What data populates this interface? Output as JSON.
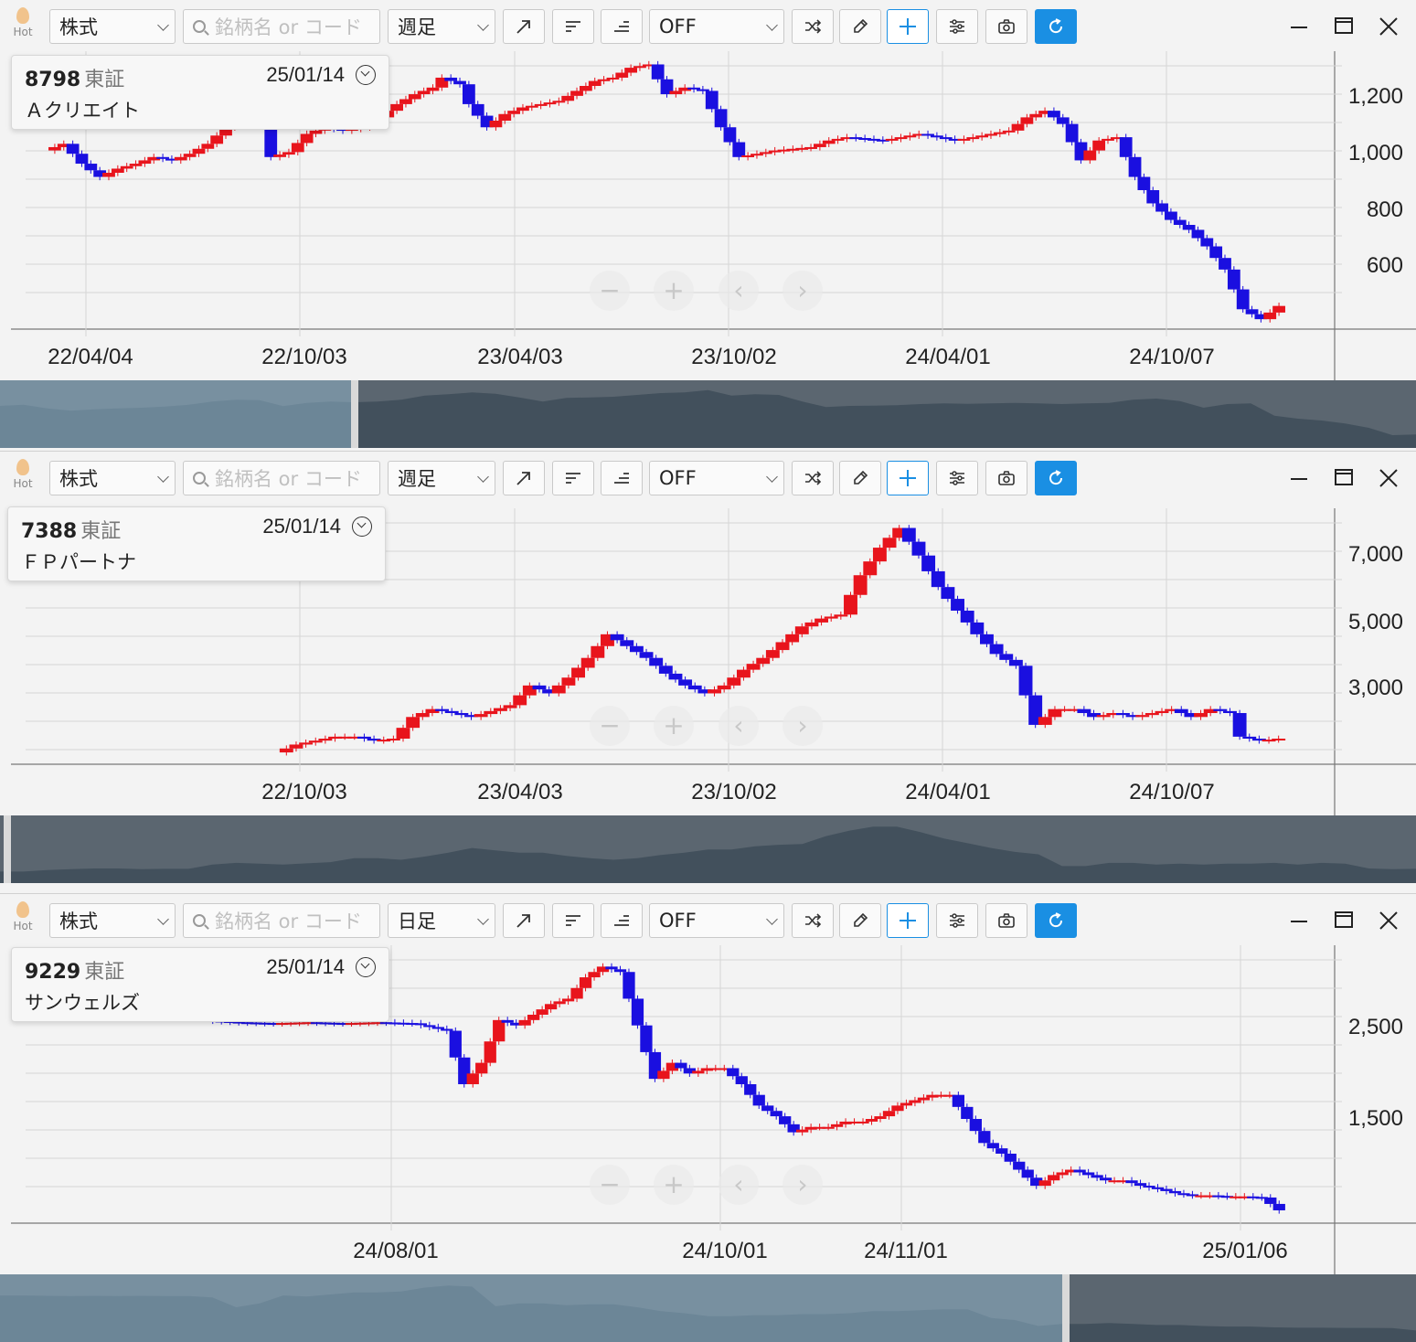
{
  "panels": [
    {
      "hot": "Hot",
      "market": "株式",
      "search_placeholder": "銘柄名 or コード",
      "period": "週足",
      "mode": "OFF",
      "code": "8798",
      "exchange": "東証",
      "date": "25/01/14",
      "name": "Ａクリエイト",
      "y_ticks": [
        "1,200",
        "1,000",
        "800",
        "600"
      ],
      "x_ticks": [
        "22/04/04",
        "22/10/03",
        "23/04/03",
        "23/10/02",
        "24/04/01",
        "24/10/07"
      ]
    },
    {
      "hot": "Hot",
      "market": "株式",
      "search_placeholder": "銘柄名 or コード",
      "period": "週足",
      "mode": "OFF",
      "code": "7388",
      "exchange": "東証",
      "date": "25/01/14",
      "name": "ＦＰパートナ",
      "y_ticks": [
        "7,000",
        "5,000",
        "3,000"
      ],
      "x_ticks": [
        "22/10/03",
        "23/04/03",
        "23/10/02",
        "24/04/01",
        "24/10/07"
      ]
    },
    {
      "hot": "Hot",
      "market": "株式",
      "search_placeholder": "銘柄名 or コード",
      "period": "日足",
      "mode": "OFF",
      "code": "9229",
      "exchange": "東証",
      "date": "25/01/14",
      "name": "サンウェルズ",
      "y_ticks": [
        "2,500",
        "1,500"
      ],
      "x_ticks": [
        "24/08/01",
        "24/10/01",
        "24/11/01",
        "25/01/06"
      ]
    }
  ],
  "colors": {
    "up": "#e8141c",
    "down": "#1a0fe0",
    "accent": "#1a8fe3",
    "grid": "#d6d6d6"
  },
  "icons": [
    "line-tool-icon",
    "align-left-icon",
    "align-right-icon",
    "shuffle-icon",
    "pencil-icon",
    "crosshair-icon",
    "settings-sliders-icon",
    "camera-icon",
    "refresh-icon"
  ],
  "chart_data": [
    {
      "type": "candlestick",
      "series_points": [
        [
          0,
          980
        ],
        [
          2,
          1000
        ],
        [
          4,
          940
        ],
        [
          6,
          900
        ],
        [
          8,
          925
        ],
        [
          10,
          940
        ],
        [
          12,
          960
        ],
        [
          14,
          950
        ],
        [
          16,
          970
        ],
        [
          18,
          1000
        ],
        [
          20,
          1050
        ],
        [
          22,
          1080
        ],
        [
          24,
          1075
        ],
        [
          25,
          960
        ],
        [
          27,
          975
        ],
        [
          29,
          1030
        ],
        [
          31,
          1050
        ],
        [
          33,
          1040
        ],
        [
          35,
          1050
        ],
        [
          37,
          1080
        ],
        [
          39,
          1120
        ],
        [
          41,
          1150
        ],
        [
          43,
          1170
        ],
        [
          44,
          1200
        ],
        [
          46,
          1180
        ],
        [
          47,
          1120
        ],
        [
          49,
          1050
        ],
        [
          51,
          1090
        ],
        [
          53,
          1110
        ],
        [
          55,
          1120
        ],
        [
          57,
          1130
        ],
        [
          59,
          1160
        ],
        [
          61,
          1190
        ],
        [
          63,
          1200
        ],
        [
          65,
          1230
        ],
        [
          67,
          1240
        ],
        [
          69,
          1150
        ],
        [
          71,
          1170
        ],
        [
          73,
          1160
        ],
        [
          75,
          1050
        ],
        [
          77,
          960
        ],
        [
          79,
          970
        ],
        [
          81,
          980
        ],
        [
          83,
          985
        ],
        [
          85,
          990
        ],
        [
          87,
          1010
        ],
        [
          89,
          1020
        ],
        [
          91,
          1015
        ],
        [
          93,
          1010
        ],
        [
          95,
          1020
        ],
        [
          97,
          1030
        ],
        [
          99,
          1020
        ],
        [
          101,
          1010
        ],
        [
          103,
          1020
        ],
        [
          105,
          1030
        ],
        [
          107,
          1040
        ],
        [
          109,
          1080
        ],
        [
          111,
          1100
        ],
        [
          113,
          1060
        ],
        [
          115,
          950
        ],
        [
          117,
          1010
        ],
        [
          119,
          1020
        ],
        [
          121,
          900
        ],
        [
          123,
          820
        ],
        [
          125,
          770
        ],
        [
          127,
          740
        ],
        [
          129,
          690
        ],
        [
          131,
          620
        ],
        [
          133,
          500
        ],
        [
          135,
          470
        ],
        [
          137,
          510
        ]
      ],
      "ylim": [
        440,
        1280
      ]
    },
    {
      "type": "candlestick",
      "series_points": [
        [
          0,
          1800
        ],
        [
          2,
          2000
        ],
        [
          4,
          2100
        ],
        [
          6,
          2200
        ],
        [
          8,
          2200
        ],
        [
          10,
          2100
        ],
        [
          12,
          2150
        ],
        [
          14,
          2700
        ],
        [
          16,
          2900
        ],
        [
          18,
          2800
        ],
        [
          20,
          2700
        ],
        [
          22,
          2850
        ],
        [
          24,
          3000
        ],
        [
          26,
          3500
        ],
        [
          28,
          3300
        ],
        [
          30,
          3700
        ],
        [
          32,
          4200
        ],
        [
          34,
          4800
        ],
        [
          36,
          4500
        ],
        [
          38,
          4200
        ],
        [
          40,
          3800
        ],
        [
          42,
          3500
        ],
        [
          44,
          3300
        ],
        [
          46,
          3500
        ],
        [
          48,
          3900
        ],
        [
          50,
          4200
        ],
        [
          52,
          4600
        ],
        [
          54,
          5000
        ],
        [
          56,
          5200
        ],
        [
          58,
          5300
        ],
        [
          60,
          6300
        ],
        [
          62,
          7000
        ],
        [
          64,
          7500
        ],
        [
          66,
          6800
        ],
        [
          68,
          6000
        ],
        [
          70,
          5400
        ],
        [
          72,
          4800
        ],
        [
          74,
          4300
        ],
        [
          76,
          4000
        ],
        [
          78,
          2500
        ],
        [
          80,
          2900
        ],
        [
          82,
          2900
        ],
        [
          84,
          2700
        ],
        [
          86,
          2800
        ],
        [
          88,
          2700
        ],
        [
          90,
          2800
        ],
        [
          92,
          2900
        ],
        [
          94,
          2700
        ],
        [
          96,
          2900
        ],
        [
          98,
          2800
        ],
        [
          99,
          2200
        ],
        [
          101,
          2100
        ],
        [
          103,
          2150
        ]
      ],
      "ylim": [
        1500,
        8000
      ]
    },
    {
      "type": "candlestick",
      "series_points": [
        [
          0,
          2500
        ],
        [
          4,
          2480
        ],
        [
          8,
          2470
        ],
        [
          12,
          2480
        ],
        [
          16,
          2470
        ],
        [
          20,
          2480
        ],
        [
          24,
          2470
        ],
        [
          28,
          2400
        ],
        [
          30,
          1900
        ],
        [
          32,
          2100
        ],
        [
          34,
          2500
        ],
        [
          36,
          2450
        ],
        [
          38,
          2550
        ],
        [
          40,
          2650
        ],
        [
          42,
          2700
        ],
        [
          44,
          2900
        ],
        [
          46,
          3000
        ],
        [
          48,
          2950
        ],
        [
          52,
          1950
        ],
        [
          54,
          2100
        ],
        [
          56,
          2000
        ],
        [
          58,
          2050
        ],
        [
          60,
          2050
        ],
        [
          62,
          1900
        ],
        [
          64,
          1700
        ],
        [
          66,
          1600
        ],
        [
          68,
          1450
        ],
        [
          70,
          1500
        ],
        [
          72,
          1500
        ],
        [
          74,
          1550
        ],
        [
          76,
          1550
        ],
        [
          78,
          1600
        ],
        [
          80,
          1700
        ],
        [
          82,
          1750
        ],
        [
          84,
          1800
        ],
        [
          86,
          1800
        ],
        [
          90,
          1350
        ],
        [
          92,
          1250
        ],
        [
          96,
          950
        ],
        [
          98,
          1050
        ],
        [
          100,
          1100
        ],
        [
          102,
          1050
        ],
        [
          104,
          1000
        ],
        [
          106,
          1000
        ],
        [
          108,
          950
        ],
        [
          110,
          920
        ],
        [
          112,
          880
        ],
        [
          114,
          860
        ],
        [
          116,
          860
        ],
        [
          118,
          850
        ],
        [
          120,
          850
        ],
        [
          122,
          840
        ],
        [
          124,
          720
        ]
      ],
      "ylim": [
        600,
        3200
      ]
    }
  ]
}
